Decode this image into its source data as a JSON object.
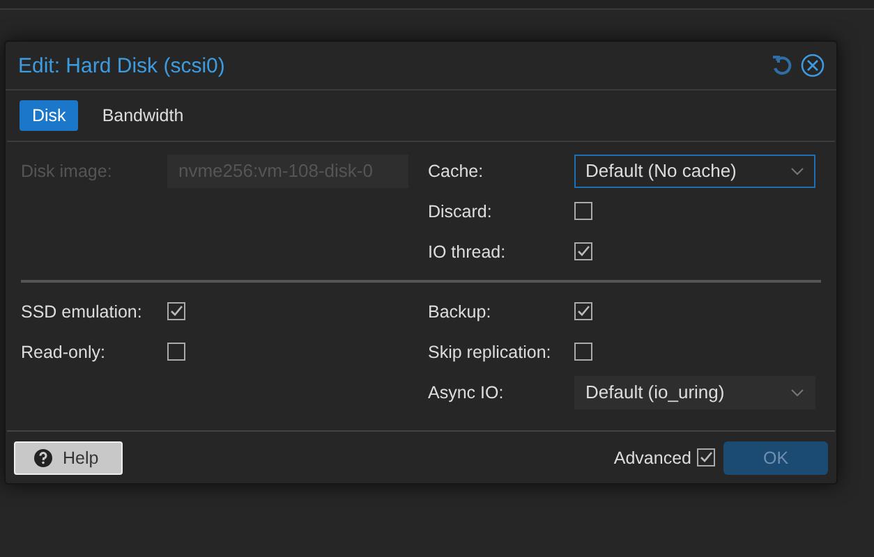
{
  "dialog": {
    "title": "Edit: Hard Disk (scsi0)",
    "tabs": [
      {
        "label": "Disk",
        "selected": true
      },
      {
        "label": "Bandwidth",
        "selected": false
      }
    ],
    "sections": [
      {
        "left": [
          {
            "kind": "text",
            "label": "Disk image:",
            "value": "nvme256:vm-108-disk-0",
            "disabled": true
          }
        ],
        "right": [
          {
            "kind": "select",
            "label": "Cache:",
            "value": "Default (No cache)",
            "focused": true
          },
          {
            "kind": "checkbox",
            "label": "Discard:",
            "checked": false
          },
          {
            "kind": "checkbox",
            "label": "IO thread:",
            "checked": true
          }
        ]
      },
      {
        "left": [
          {
            "kind": "checkbox",
            "label": "SSD emulation:",
            "checked": true
          },
          {
            "kind": "checkbox",
            "label": "Read-only:",
            "checked": false
          }
        ],
        "right": [
          {
            "kind": "checkbox",
            "label": "Backup:",
            "checked": true
          },
          {
            "kind": "checkbox",
            "label": "Skip replication:",
            "checked": false
          },
          {
            "kind": "select",
            "label": "Async IO:",
            "value": "Default (io_uring)",
            "focused": false
          }
        ]
      }
    ],
    "footer": {
      "help": "Help",
      "advanced": {
        "label": "Advanced",
        "checked": true
      },
      "ok": {
        "label": "OK",
        "disabled": true
      }
    }
  }
}
